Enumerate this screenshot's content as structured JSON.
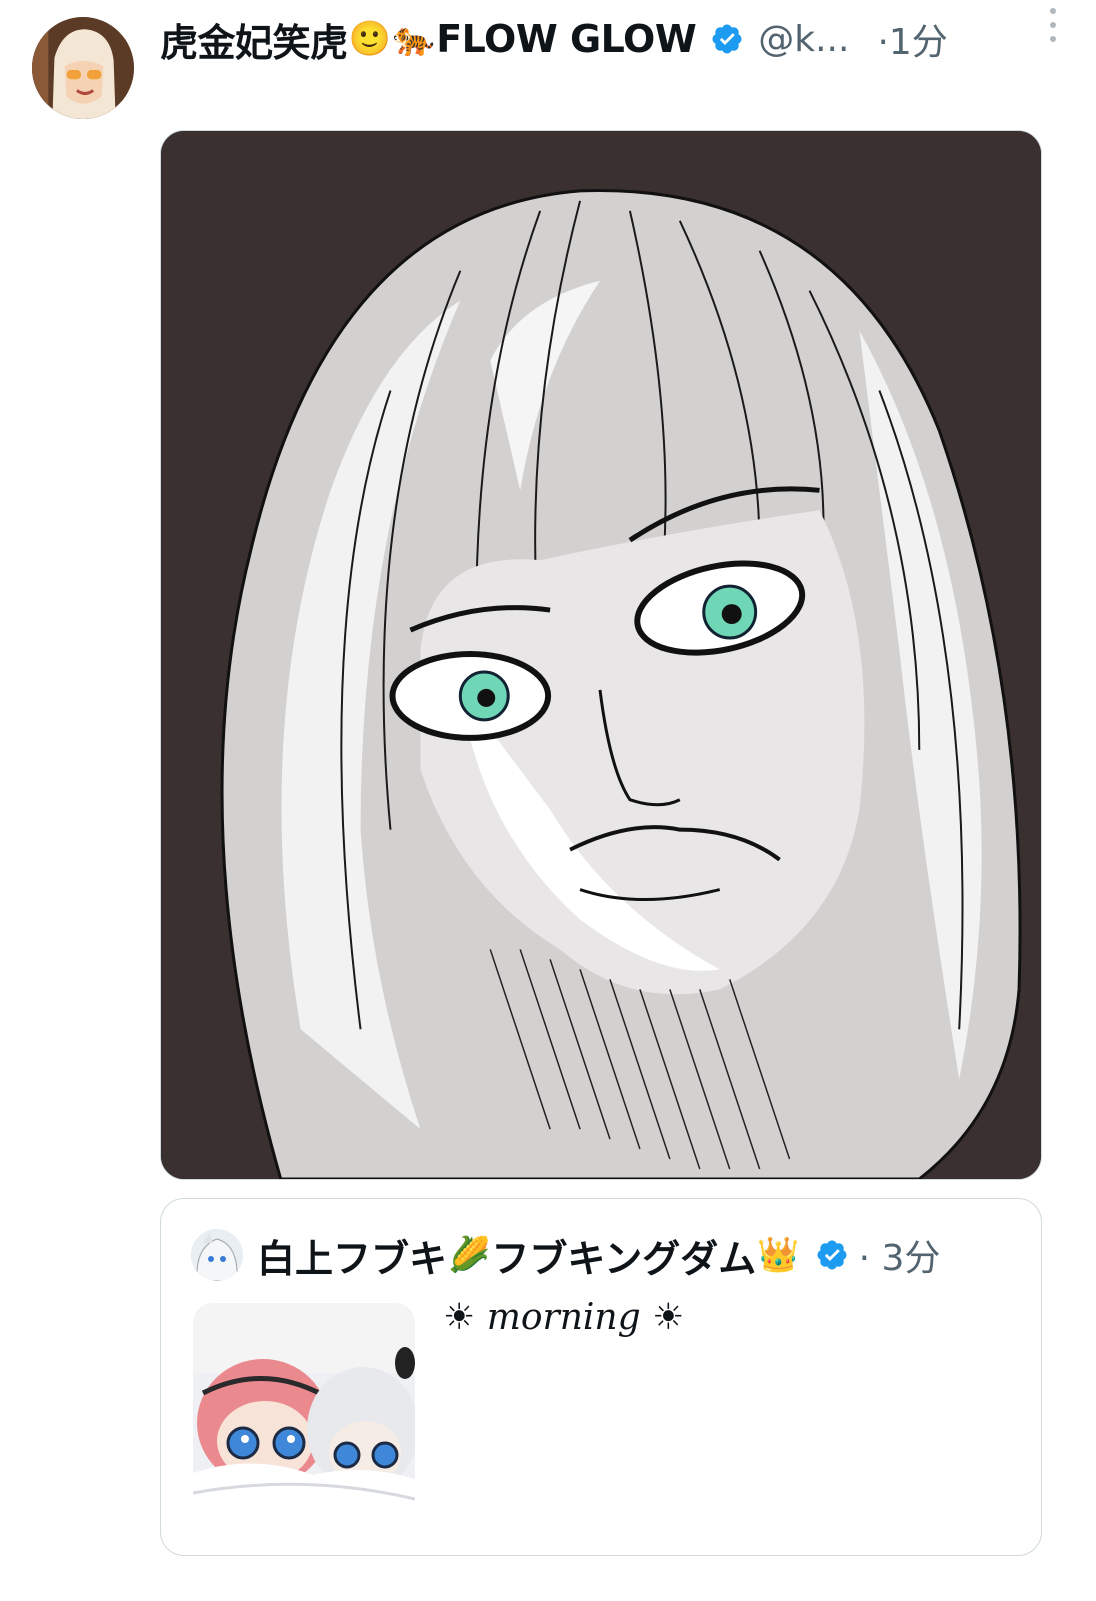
{
  "post": {
    "author": {
      "display_name": "虎金妃笑虎",
      "emoji_1": "🙂",
      "emoji_2": "🐅",
      "display_name_suffix": "FLOW GLOW",
      "handle": "@k...",
      "verified": true,
      "avatar_icon": "avatar-image"
    },
    "time": "·1分",
    "more_icon": "more-vertical-icon",
    "media": {
      "icon": "illustration-image"
    }
  },
  "quote": {
    "author": {
      "display_name": "白上フブキ",
      "emoji_1": "🌽",
      "display_name_suffix": "フブキングダム",
      "emoji_2": "👑",
      "verified": true
    },
    "time": "· 3分",
    "text": "☀ morning ☀"
  },
  "colors": {
    "verified": "#1d9bf0",
    "secondary_text": "#536471",
    "border": "#cfd9de",
    "media_background": "#3a302f"
  }
}
